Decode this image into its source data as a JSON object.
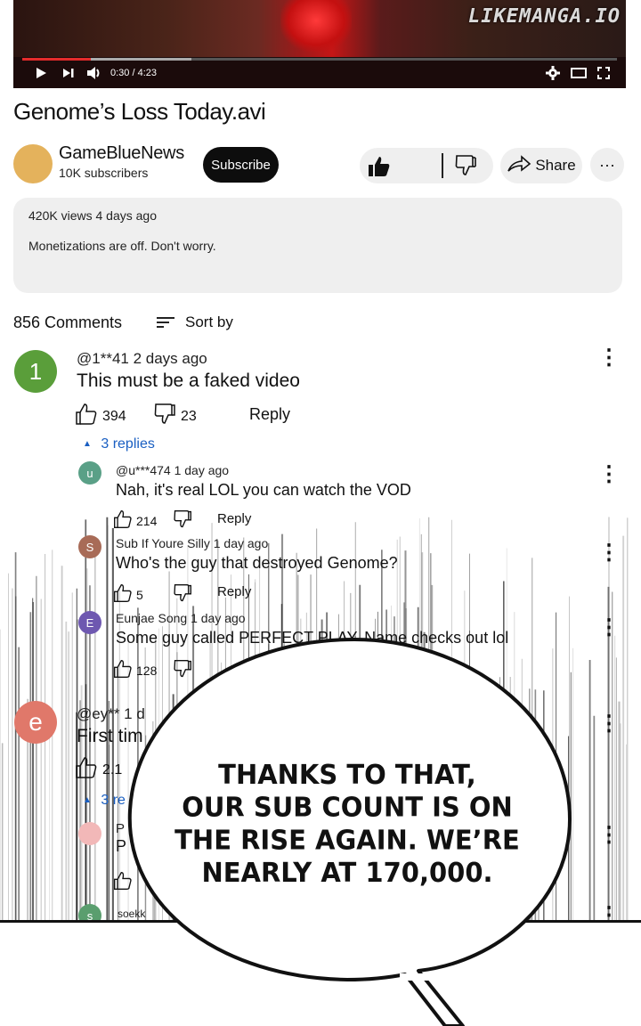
{
  "video": {
    "watermark": "LIKEMANGA.IO",
    "time": "0:30 / 4:23",
    "progress_fraction": 0.115,
    "title": "Genome’s Loss Today.avi"
  },
  "channel": {
    "name": "GameBlueNews",
    "subscribers": "10K subscribers",
    "subscribe_label": "Subscribe",
    "share_label": "Share",
    "more_label": "···",
    "avatar_color": "#e4b25c"
  },
  "description": {
    "meta": "420K views 4 days ago",
    "text": "Monetizations are off. Don't worry."
  },
  "comments_header": {
    "count": "856 Comments",
    "sort_label": "Sort by"
  },
  "comments": [
    {
      "avatar": "1",
      "avatar_color": "#5a9e3a",
      "header": "@1**41 2 days ago",
      "text": "This must be a faked video",
      "likes": "394",
      "dislikes": "23",
      "reply_label": "Reply",
      "replies_toggle": "3 replies",
      "replies": [
        {
          "avatar": "u",
          "avatar_color": "#5aa087",
          "header": "@u***474 1 day ago",
          "text": "Nah, it's real LOL you can watch the VOD",
          "likes": "214",
          "reply_label": "Reply"
        },
        {
          "avatar": "S",
          "avatar_color": "#a86b57",
          "header": "Sub If Youre Silly 1 day ago",
          "text": "Who's the guy that destroyed Genome?",
          "likes": "5",
          "reply_label": "Reply"
        },
        {
          "avatar": "E",
          "avatar_color": "#6e58b0",
          "header": "Eunjae Song 1 day ago",
          "text": "Some guy called PERFECT PLAY. Name checks out lol",
          "likes": "128",
          "reply_label": "Reply"
        }
      ]
    },
    {
      "avatar": "e",
      "avatar_color": "#e0786a",
      "header": "@ey** 1 d",
      "text": "First tim",
      "likes": "2.1",
      "replies_toggle": "3 re",
      "replies": [
        {
          "avatar": "",
          "avatar_color": "#f2b8b8",
          "header": "P",
          "text": "P"
        },
        {
          "avatar": "s",
          "avatar_color": "#5a9e6e",
          "header": "soekk",
          "text": ""
        }
      ]
    }
  ],
  "speech_bubble": {
    "lines": [
      "THANKS TO THAT,",
      "OUR SUB COUNT IS ON",
      "THE RISE AGAIN. WE’RE",
      "NEARLY AT 170,000."
    ]
  }
}
